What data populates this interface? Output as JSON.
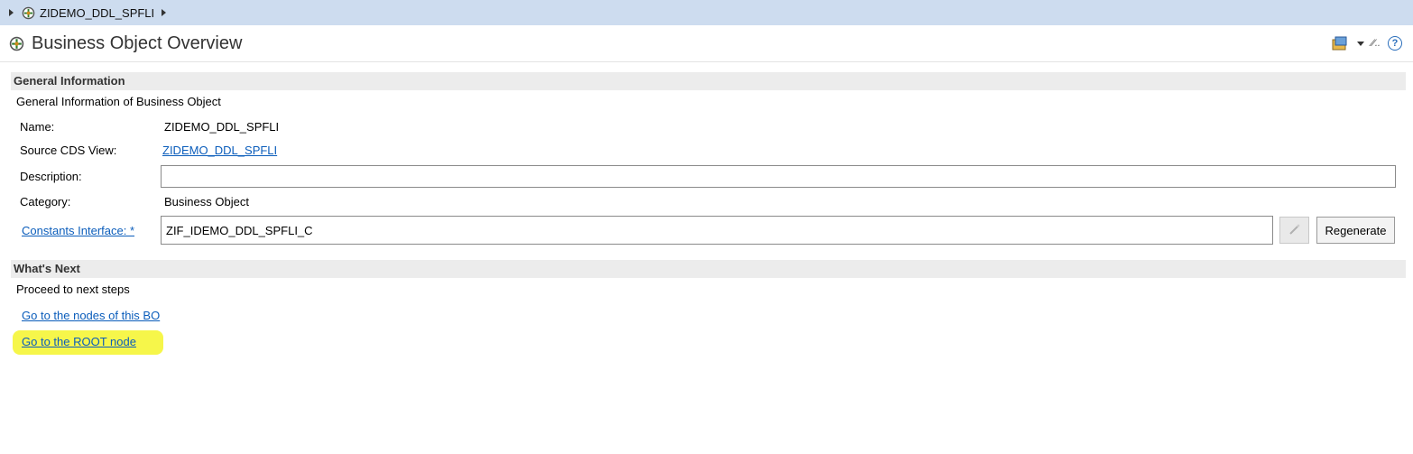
{
  "breadcrumb": {
    "label": "ZIDEMO_DDL_SPFLI"
  },
  "header": {
    "title": "Business Object Overview"
  },
  "general_info": {
    "section_title": "General Information",
    "description": "General Information of Business Object",
    "name_label": "Name:",
    "name_value": "ZIDEMO_DDL_SPFLI",
    "source_label": "Source CDS View:",
    "source_value": "ZIDEMO_DDL_SPFLI",
    "description_label": "Description:",
    "description_value": "",
    "category_label": "Category:",
    "category_value": "Business Object",
    "constants_label": "Constants Interface: *",
    "constants_value": "ZIF_IDEMO_DDL_SPFLI_C",
    "regenerate_label": "Regenerate"
  },
  "whats_next": {
    "section_title": "What's Next",
    "description": "Proceed to next steps",
    "links": [
      {
        "label": "Go to the nodes of this BO"
      },
      {
        "label": "Go to the ROOT node",
        "highlighted": true
      }
    ]
  },
  "colors": {
    "accent": "#0b5dbb",
    "breadcrumb_bg": "#cddcef",
    "section_bg": "#ececec",
    "highlight": "#f6f64a"
  },
  "icons": [
    "bo-icon",
    "wand-icon",
    "dropdown-icon",
    "pin-icon",
    "help-icon"
  ]
}
